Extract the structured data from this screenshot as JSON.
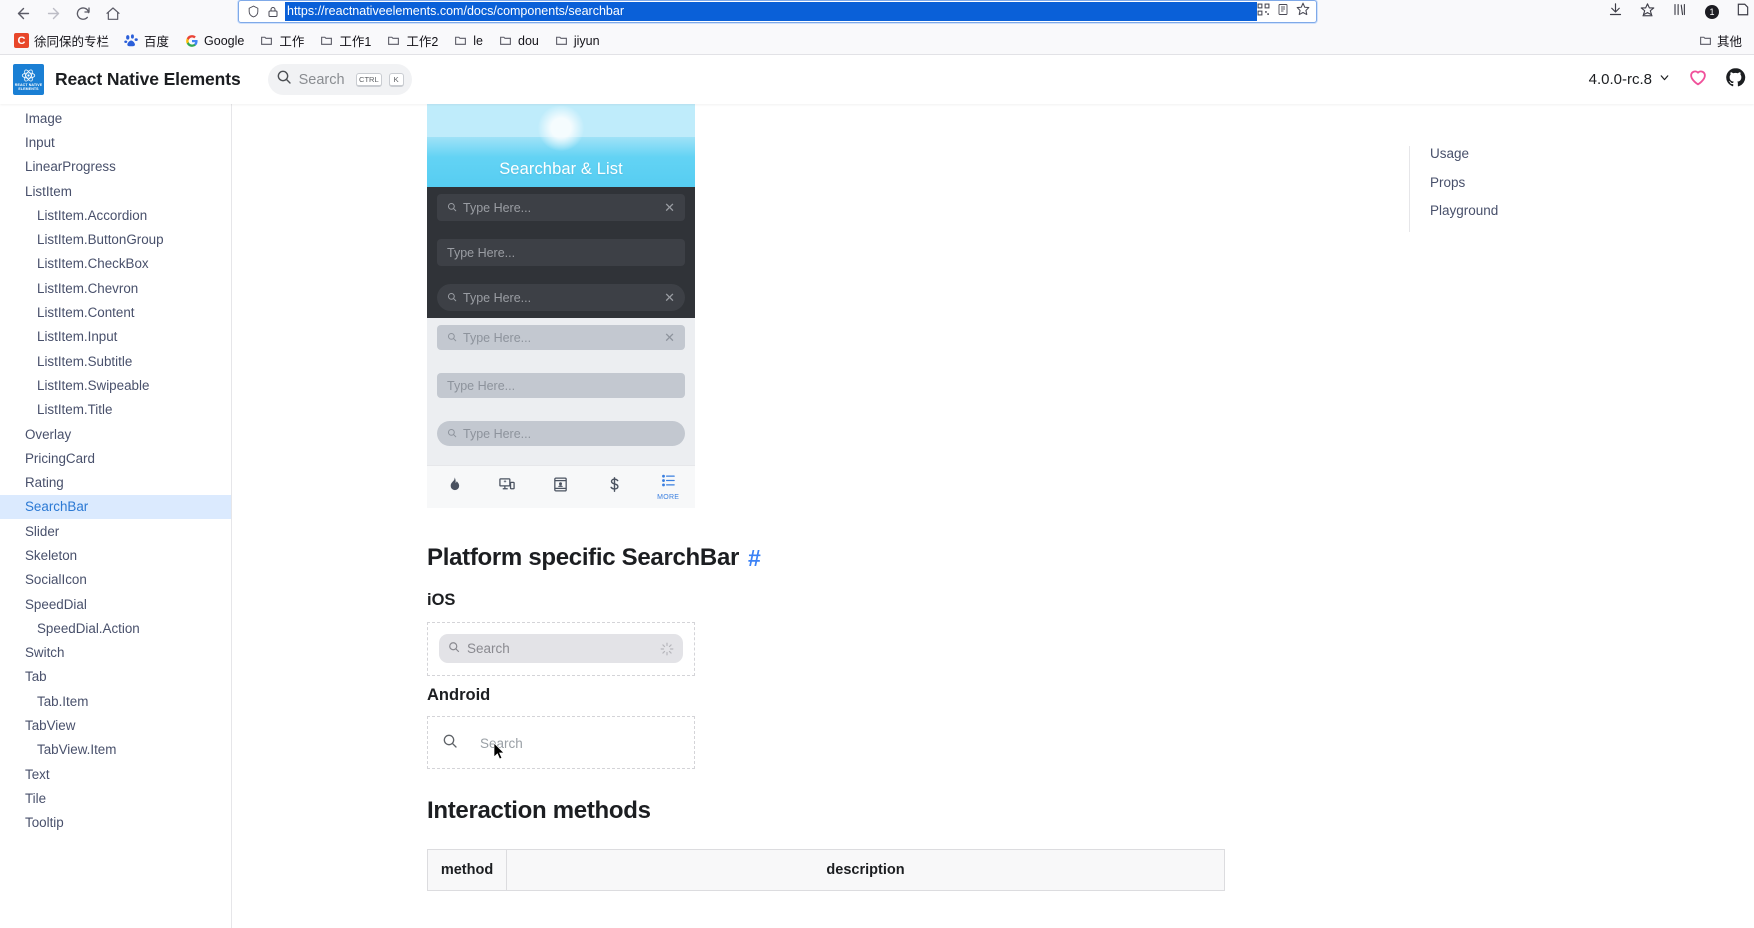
{
  "browser": {
    "nav": {
      "back": "back-arrow",
      "forward": "forward-arrow",
      "reload": "reload",
      "home": "home"
    },
    "url": "https://reactnativeelements.com/docs/components/searchbar",
    "url_icons": [
      "shield-icon",
      "lock-icon"
    ],
    "url_right_icons": [
      "qrcode-icon",
      "reader-icon",
      "bookmark-star-icon"
    ],
    "chrome_right_icons": [
      "downloads-icon",
      "pocket-icon",
      "library-icon",
      "account-badge"
    ],
    "account_badge": "1",
    "bookmarks": [
      {
        "label": "徐同保的专栏",
        "icon": "csdn-favicon"
      },
      {
        "label": "百度",
        "icon": "baidu-favicon"
      },
      {
        "label": "Google",
        "icon": "google-favicon"
      },
      {
        "label": "工作",
        "icon": "folder-icon"
      },
      {
        "label": "工作1",
        "icon": "folder-icon"
      },
      {
        "label": "工作2",
        "icon": "folder-icon"
      },
      {
        "label": "le",
        "icon": "folder-icon"
      },
      {
        "label": "dou",
        "icon": "folder-icon"
      },
      {
        "label": "jiyun",
        "icon": "folder-icon"
      }
    ],
    "bookmarks_overflow": {
      "label": "其他",
      "icon": "folder-icon"
    }
  },
  "site": {
    "title": "React Native Elements",
    "logo_text": "REACT NATIVE ELEMENTS",
    "search": {
      "placeholder": "Search",
      "kbd": [
        "CTRL",
        "K"
      ]
    },
    "version": "4.0.0-rc.8",
    "icons": [
      "heart-icon",
      "github-icon"
    ]
  },
  "sidebar": {
    "items": [
      {
        "label": "Image",
        "level": 0,
        "active": false
      },
      {
        "label": "Input",
        "level": 0,
        "active": false
      },
      {
        "label": "LinearProgress",
        "level": 0,
        "active": false
      },
      {
        "label": "ListItem",
        "level": 0,
        "active": false
      },
      {
        "label": "ListItem.Accordion",
        "level": 1,
        "active": false
      },
      {
        "label": "ListItem.ButtonGroup",
        "level": 1,
        "active": false
      },
      {
        "label": "ListItem.CheckBox",
        "level": 1,
        "active": false
      },
      {
        "label": "ListItem.Chevron",
        "level": 1,
        "active": false
      },
      {
        "label": "ListItem.Content",
        "level": 1,
        "active": false
      },
      {
        "label": "ListItem.Input",
        "level": 1,
        "active": false
      },
      {
        "label": "ListItem.Subtitle",
        "level": 1,
        "active": false
      },
      {
        "label": "ListItem.Swipeable",
        "level": 1,
        "active": false
      },
      {
        "label": "ListItem.Title",
        "level": 1,
        "active": false
      },
      {
        "label": "Overlay",
        "level": 0,
        "active": false
      },
      {
        "label": "PricingCard",
        "level": 0,
        "active": false
      },
      {
        "label": "Rating",
        "level": 0,
        "active": false
      },
      {
        "label": "SearchBar",
        "level": 0,
        "active": true
      },
      {
        "label": "Slider",
        "level": 0,
        "active": false
      },
      {
        "label": "Skeleton",
        "level": 0,
        "active": false
      },
      {
        "label": "SocialIcon",
        "level": 0,
        "active": false
      },
      {
        "label": "SpeedDial",
        "level": 0,
        "active": false
      },
      {
        "label": "SpeedDial.Action",
        "level": 1,
        "active": false
      },
      {
        "label": "Switch",
        "level": 0,
        "active": false
      },
      {
        "label": "Tab",
        "level": 0,
        "active": false
      },
      {
        "label": "Tab.Item",
        "level": 1,
        "active": false
      },
      {
        "label": "TabView",
        "level": 0,
        "active": false
      },
      {
        "label": "TabView.Item",
        "level": 1,
        "active": false
      },
      {
        "label": "Text",
        "level": 0,
        "active": false
      },
      {
        "label": "Tile",
        "level": 0,
        "active": false
      },
      {
        "label": "Tooltip",
        "level": 0,
        "active": false
      }
    ]
  },
  "toc": {
    "items": [
      "Usage",
      "Props",
      "Playground"
    ]
  },
  "preview": {
    "hero_title": "Searchbar & List",
    "searchbars": [
      {
        "theme": "dark",
        "placeholder": "Type Here...",
        "has_search_icon": true,
        "has_clear": true,
        "round": false
      },
      {
        "theme": "dark",
        "placeholder": "Type Here...",
        "has_search_icon": false,
        "has_clear": false,
        "round": false
      },
      {
        "theme": "dark",
        "placeholder": "Type Here...",
        "has_search_icon": true,
        "has_clear": true,
        "round": true
      },
      {
        "theme": "light",
        "placeholder": "Type Here...",
        "has_search_icon": true,
        "has_clear": true,
        "round": false
      },
      {
        "theme": "light",
        "placeholder": "Type Here...",
        "has_search_icon": false,
        "has_clear": false,
        "round": false
      },
      {
        "theme": "light",
        "placeholder": "Type Here...",
        "has_search_icon": true,
        "has_clear": false,
        "round": true
      }
    ],
    "tabbar": [
      {
        "icon": "flame-icon",
        "label": "",
        "active": false
      },
      {
        "icon": "devices-icon",
        "label": "",
        "active": false
      },
      {
        "icon": "contact-card-icon",
        "label": "",
        "active": false
      },
      {
        "icon": "dollar-icon",
        "label": "",
        "active": false
      },
      {
        "icon": "list-icon",
        "label": "MORE",
        "active": true
      }
    ]
  },
  "content": {
    "platform_heading": "Platform specific SearchBar",
    "anchor": "#",
    "ios_label": "iOS",
    "ios_placeholder": "Search",
    "android_label": "Android",
    "android_placeholder": "Search",
    "interaction_heading": "Interaction methods",
    "table": {
      "headers": [
        "method",
        "description"
      ]
    }
  },
  "colors": {
    "accent": "#3b82f6",
    "sidebar_active_bg": "#dbeafe",
    "sidebar_active_fg": "#2b79d4",
    "logo_blue": "#1a7fd4",
    "heart_pink": "#f0509a",
    "hero_cyan": "#56cdf2",
    "url_selection": "#0a60d8"
  }
}
